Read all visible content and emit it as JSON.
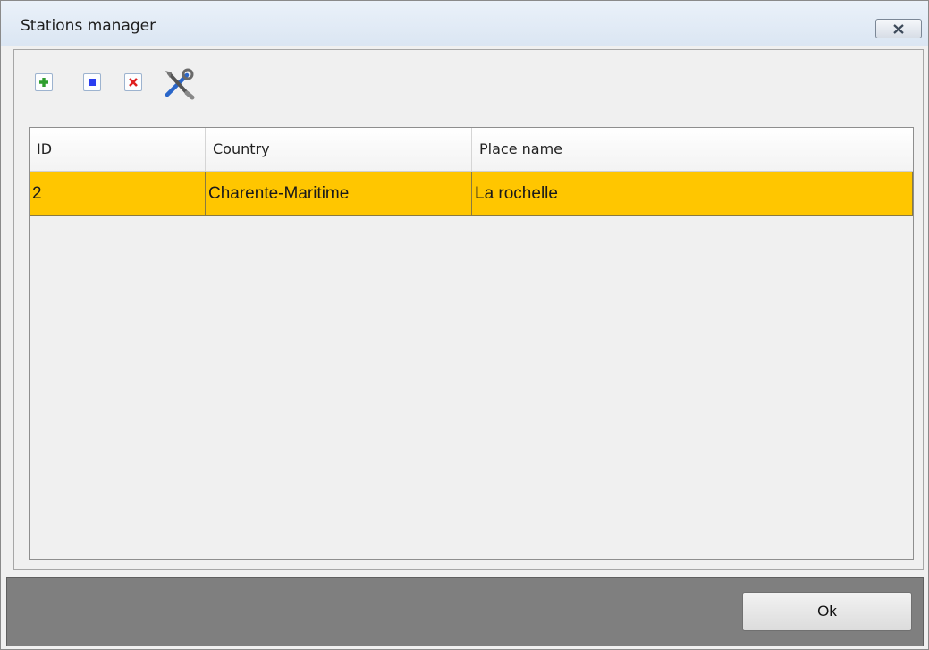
{
  "window": {
    "title": "Stations manager"
  },
  "toolbar": {
    "buttons": [
      {
        "name": "add",
        "icon": "add-document-icon",
        "color": "#2e9e2e"
      },
      {
        "name": "edit",
        "icon": "edit-document-icon",
        "color": "#2a3df0"
      },
      {
        "name": "delete",
        "icon": "delete-document-icon",
        "color": "#e02020"
      },
      {
        "name": "settings",
        "icon": "tools-icon"
      }
    ]
  },
  "table": {
    "columns": [
      "ID",
      "Country",
      "Place name"
    ],
    "rows": [
      {
        "id": "2",
        "country": "Charente-Maritime",
        "place": "La rochelle",
        "selected": true
      }
    ],
    "selection_color": "#ffc600"
  },
  "footer": {
    "ok_label": "Ok"
  }
}
